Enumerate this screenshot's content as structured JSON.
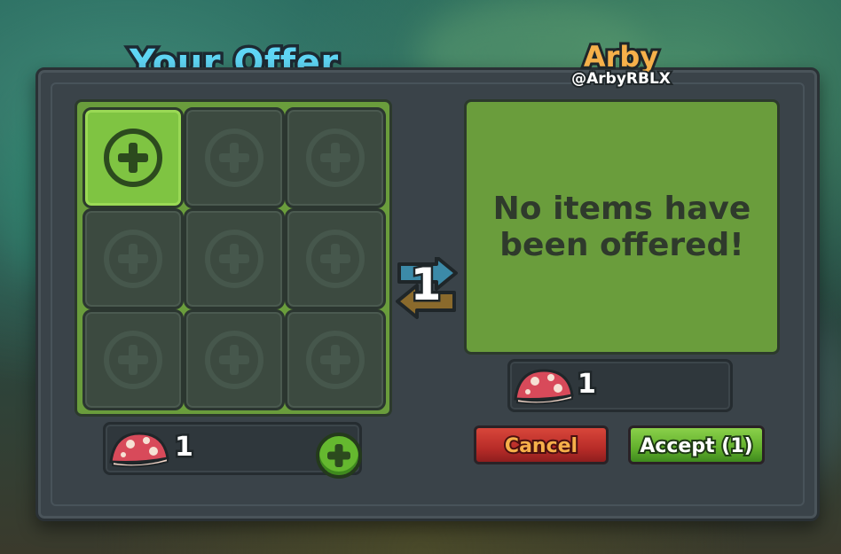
{
  "title": "Your Offer",
  "partner": {
    "name": "Arby",
    "handle": "@ArbyRBLX",
    "empty_message": "No items have been offered!",
    "currency_amount": "1"
  },
  "my_offer": {
    "currency_amount": "1",
    "slots": 9
  },
  "swap_count": "1",
  "buttons": {
    "cancel": "Cancel",
    "accept": "Accept (1)"
  },
  "colors": {
    "title": "#5fd6f5",
    "partner_name": "#f6b04a",
    "panel_green": "#6a9d3c",
    "cancel": "#c8362e",
    "accept": "#62b02c"
  },
  "icons": {
    "currency": "mushroom-icon",
    "add": "plus-icon",
    "swap": "swap-arrows-icon"
  }
}
